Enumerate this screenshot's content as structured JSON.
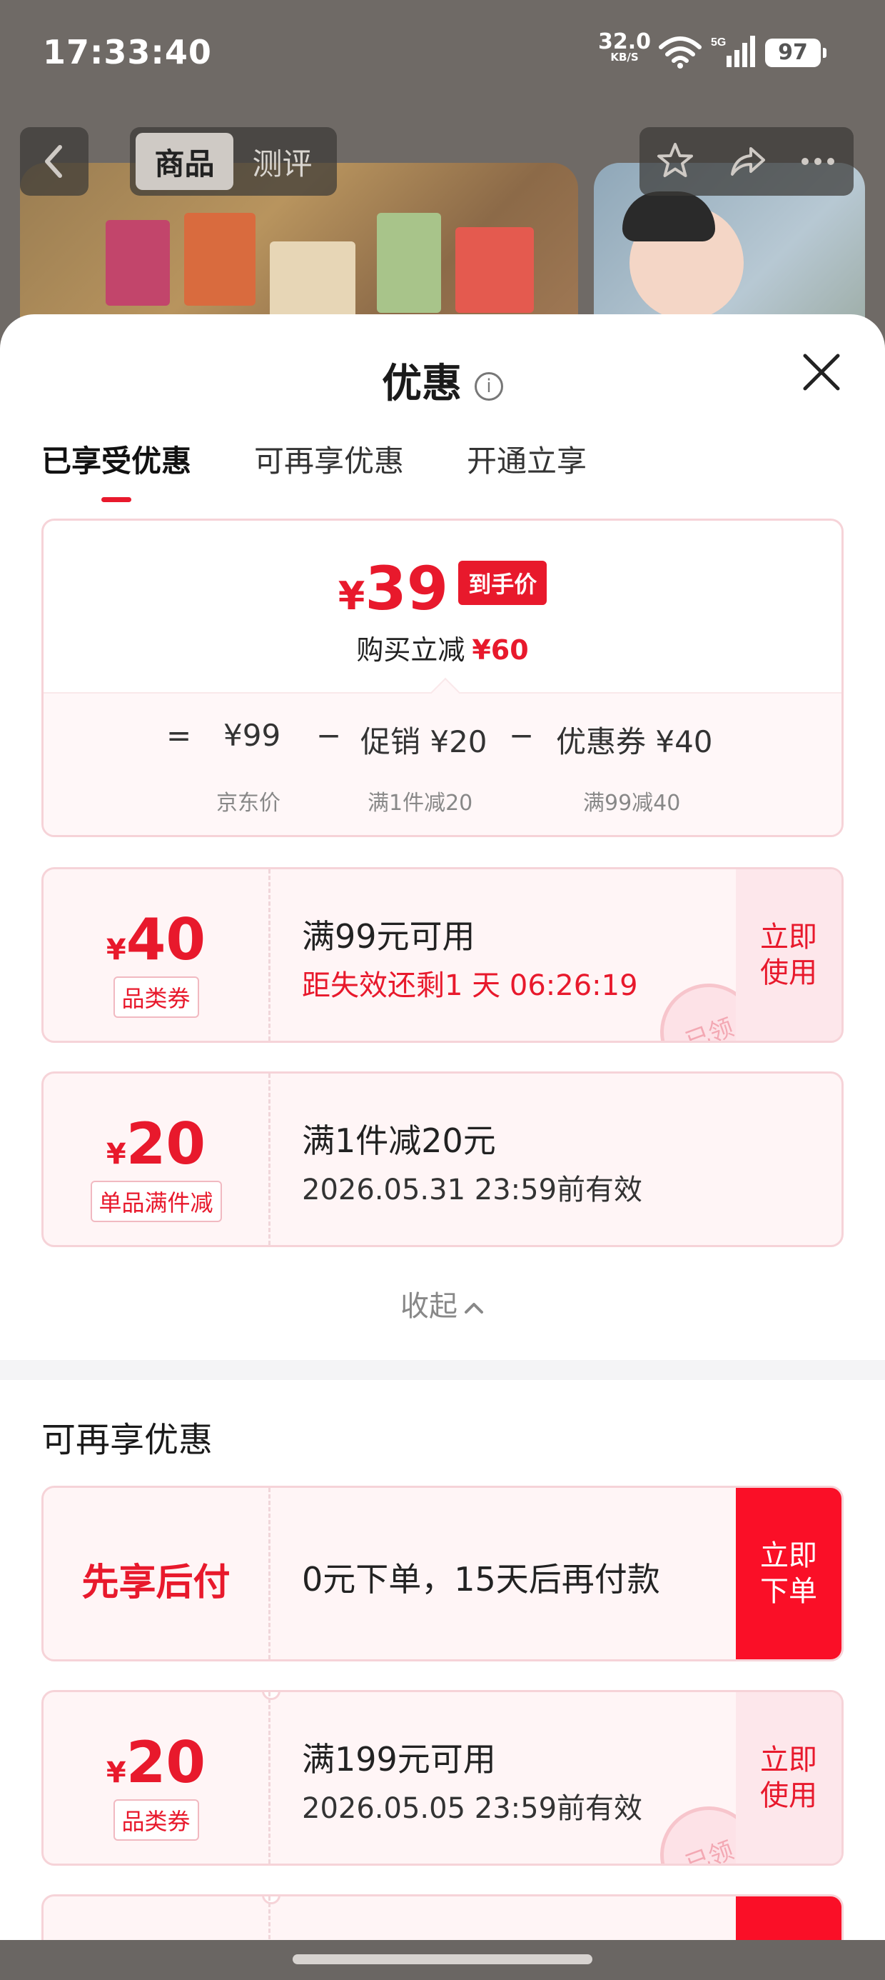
{
  "status_bar": {
    "time": "17:33:40",
    "net_speed": "32.0",
    "net_unit": "KB/S",
    "signal_label": "5G",
    "battery": "97"
  },
  "product_nav": {
    "tabs": [
      "商品",
      "测评"
    ],
    "active_tab": "商品"
  },
  "sheet": {
    "title": "优惠",
    "info_glyph": "i",
    "tabs": [
      "已享受优惠",
      "可再享优惠",
      "开通立享"
    ],
    "active_tab_index": 0
  },
  "price_summary": {
    "currency": "¥",
    "final_price": "39",
    "final_tag": "到手价",
    "save_label": "购买立减",
    "save_amount": "¥60",
    "formula": {
      "equals": "=",
      "base": "¥99",
      "minus1": "−",
      "promo": "促销 ¥20",
      "minus2": "−",
      "coupon": "优惠券 ¥40"
    },
    "formula_sub": {
      "base_label": "京东价",
      "promo_label": "满1件减20",
      "coupon_label": "满99减40"
    }
  },
  "enjoyed_coupons": [
    {
      "currency": "¥",
      "value": "40",
      "type": "品类券",
      "line1": "满99元可用",
      "line2": "距失效还剩1 天 06:26:19",
      "action": "立即\n使用",
      "stamp": "已领"
    },
    {
      "currency": "¥",
      "value": "20",
      "type": "单品满件减",
      "line1": "满1件减20元",
      "line2": "2026.05.31 23:59前有效"
    }
  ],
  "collapse_label": "收起",
  "more_section": {
    "title": "可再享优惠",
    "items": [
      {
        "label": "先享后付",
        "line1": "0元下单，15天后再付款",
        "action": "立即\n下单"
      },
      {
        "currency": "¥",
        "value": "20",
        "type": "品类券",
        "line1": "满199元可用",
        "line2": "2026.05.05 23:59前有效",
        "action": "立即\n使用",
        "stamp": "已领"
      }
    ]
  },
  "colors": {
    "accent": "#e8192c",
    "accent_solid": "#fa0f27",
    "coupon_bg": "#fff5f6",
    "coupon_border": "#f6d3d8"
  }
}
